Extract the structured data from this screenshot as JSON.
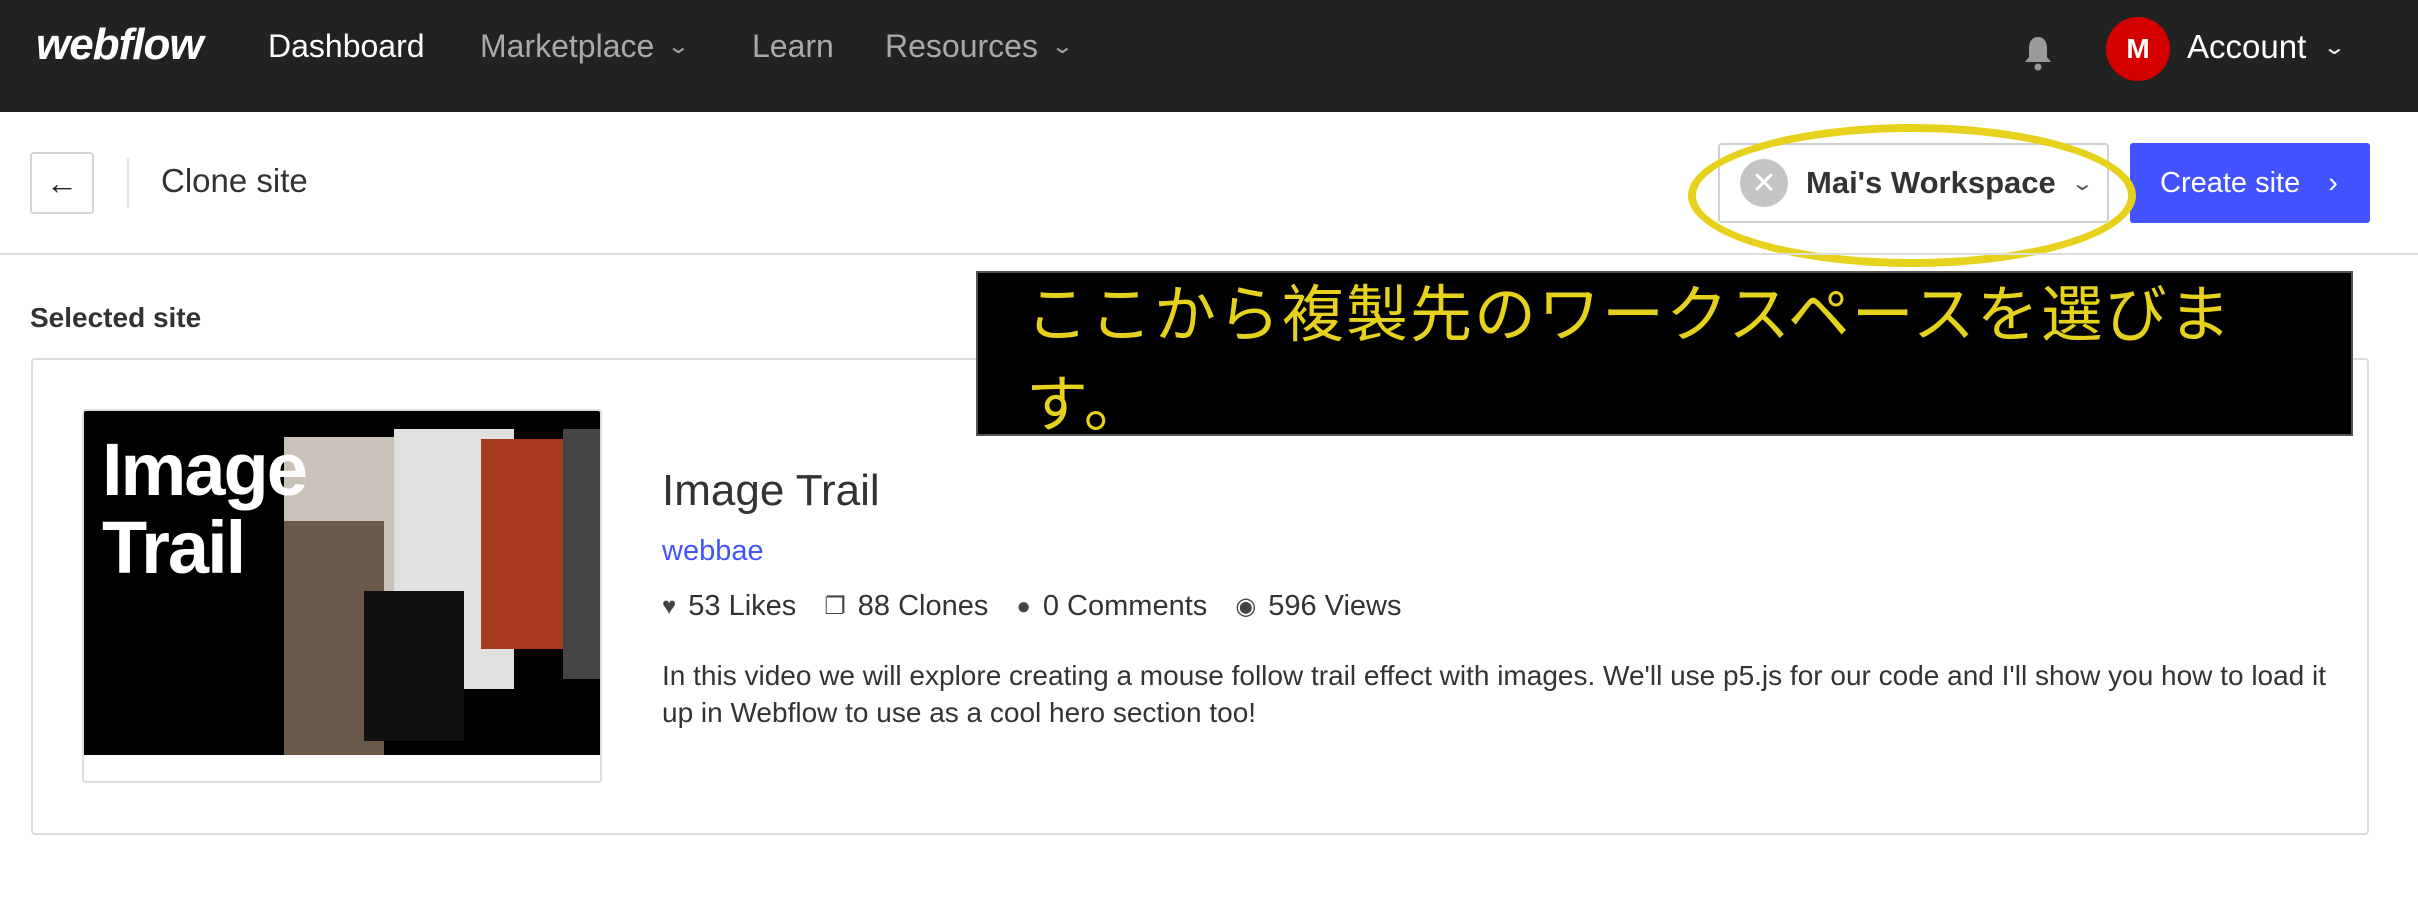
{
  "nav": {
    "logo": "webflow",
    "items": [
      {
        "label": "Dashboard"
      },
      {
        "label": "Marketplace"
      },
      {
        "label": "Learn"
      },
      {
        "label": "Resources"
      }
    ],
    "avatar_initial": "M",
    "account_label": "Account"
  },
  "header": {
    "title": "Clone site",
    "workspace": "Mai's Workspace",
    "create_label": "Create site"
  },
  "main": {
    "section_label": "Selected site",
    "site": {
      "thumbnail_text": "Image Trail",
      "title": "Image Trail",
      "author": "webbae",
      "stats": [
        {
          "icon": "heart-icon",
          "label": "53 Likes"
        },
        {
          "icon": "clone-icon",
          "label": "88 Clones"
        },
        {
          "icon": "comment-icon",
          "label": "0 Comments"
        },
        {
          "icon": "eye-icon",
          "label": "596 Views"
        }
      ],
      "description": "In this video we will explore creating a mouse follow trail effect with images. We'll use p5.js for our code and I'll show you how to load it up in Webflow to use as a cool hero section too!"
    }
  },
  "annotation": {
    "text": "ここから複製先のワークスペースを選びます。",
    "color": "#e6d21c"
  },
  "colors": {
    "accent": "#4353ff",
    "avatar": "#d40000",
    "nav_bg": "#222222"
  }
}
